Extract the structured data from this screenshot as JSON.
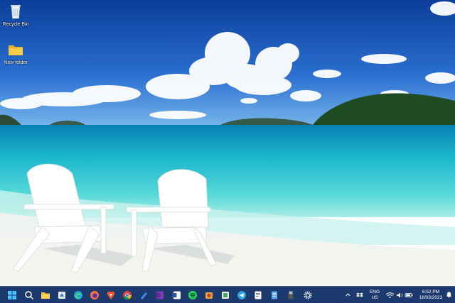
{
  "desktop": {
    "icons": [
      {
        "label": "Recycle Bin",
        "icon": "recycle-bin-icon"
      },
      {
        "label": "New folder",
        "icon": "folder-icon"
      }
    ],
    "wallpaper": "beach-with-two-white-chairs"
  },
  "taskbar": {
    "apps": [
      "start-icon",
      "search-icon",
      "file-explorer-icon",
      "app-icon",
      "edge-icon",
      "firefox-icon",
      "brave-icon",
      "chrome-icon",
      "app-icon",
      "onenote-icon",
      "word-icon",
      "spotify-icon",
      "app-icon",
      "app-icon",
      "telegram-icon",
      "notepad-icon",
      "notes-icon",
      "usb-icon",
      "settings-icon"
    ],
    "tray": {
      "lang_top": "ENG",
      "lang_bottom": "US",
      "time": "6:52 PM",
      "date": "18/03/2023"
    }
  },
  "colors": {
    "taskbar": "#1d3a6e",
    "accent": "#3b8ee8"
  }
}
